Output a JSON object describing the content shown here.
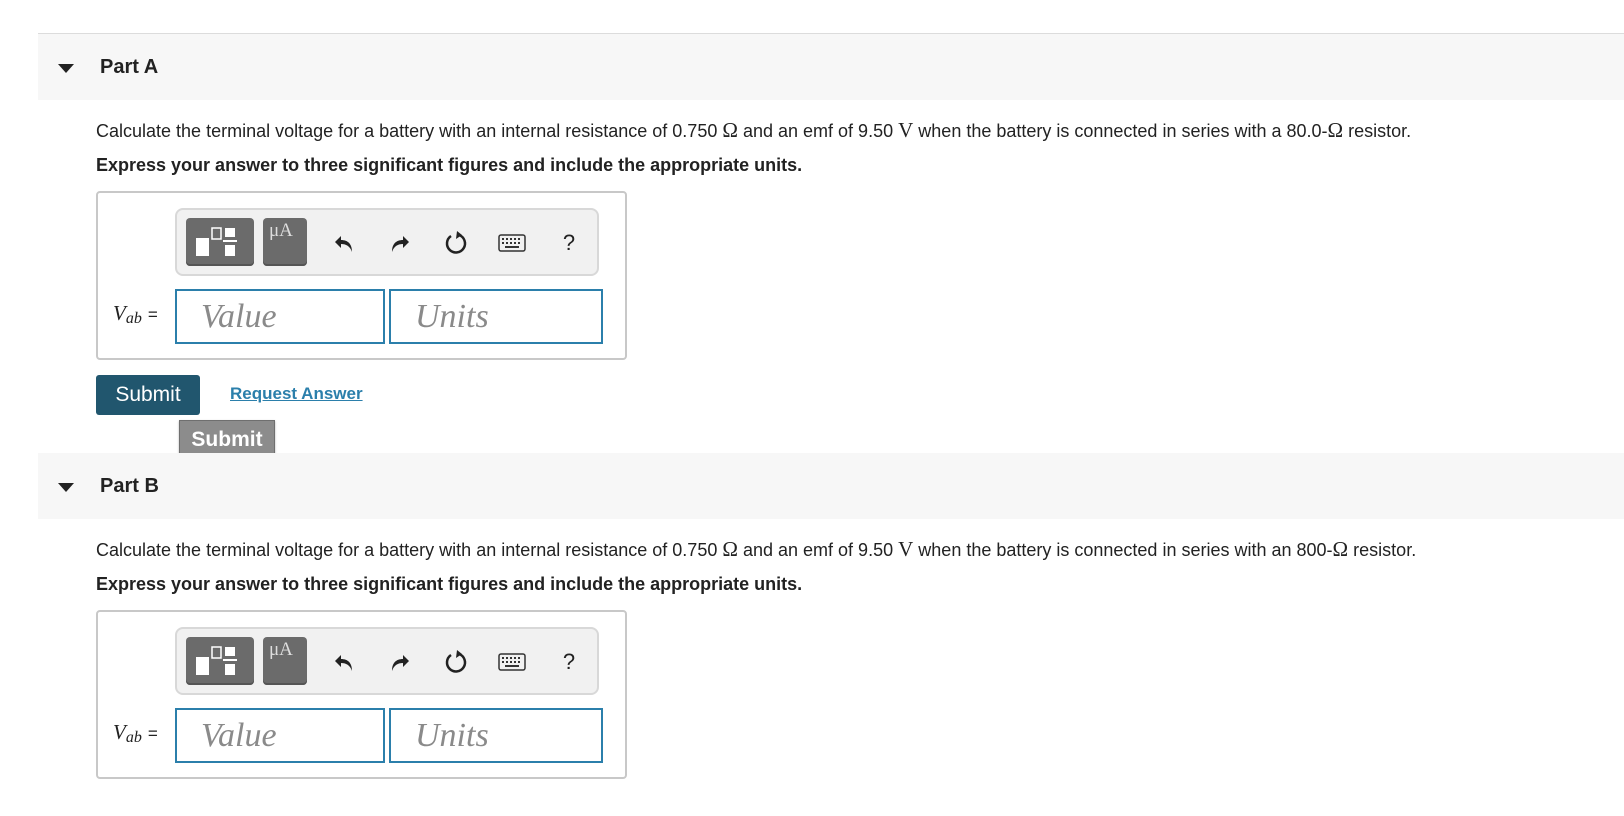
{
  "partA": {
    "title": "Part A",
    "question_pre": "Calculate the terminal voltage for a battery with an internal resistance of 0.750",
    "question_mid1": "and an emf of 9.50",
    "question_mid2": "when the battery is connected in series with a 80.0-",
    "question_post": "resistor.",
    "ohm_symbol": "Ω",
    "volt_symbol": "V",
    "instruction": "Express your answer to three significant figures and include the appropriate units.",
    "variable_symbol": "V",
    "variable_sub": "ab",
    "equals": "=",
    "value_placeholder": "Value",
    "units_placeholder": "Units",
    "help_label": "?",
    "submit_label": "Submit",
    "request_answer_label": "Request Answer",
    "tooltip_label": "Submit"
  },
  "partB": {
    "title": "Part B",
    "question_pre": "Calculate the terminal voltage for a battery with an internal resistance of 0.750",
    "question_mid1": "and an emf of 9.50",
    "question_mid2": "when the battery is connected in series with an 800-",
    "question_post": "resistor.",
    "ohm_symbol": "Ω",
    "volt_symbol": "V",
    "instruction": "Express your answer to three significant figures and include the appropriate units.",
    "variable_symbol": "V",
    "variable_sub": "ab",
    "equals": "=",
    "value_placeholder": "Value",
    "units_placeholder": "Units",
    "help_label": "?"
  },
  "toolbar": {
    "units_button_glyph": "μA"
  },
  "colors": {
    "submit_bg": "#21566e",
    "input_border": "#2b7fab",
    "link": "#2b7fab",
    "tooltip_bg": "#8c8c8c"
  }
}
